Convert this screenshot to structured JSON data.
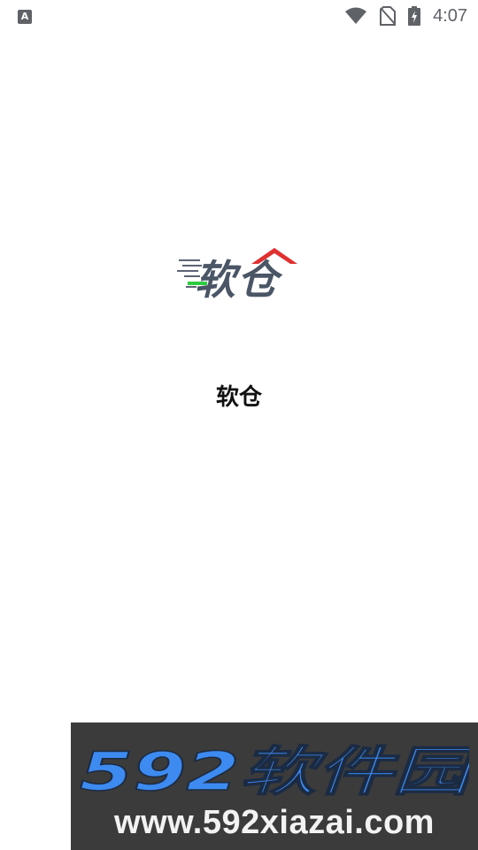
{
  "status_bar": {
    "time": "4:07",
    "left_icon_letter": "A",
    "icons": [
      "keyboard-indicator-icon",
      "wifi-icon",
      "no-sim-icon",
      "battery-charging-icon"
    ]
  },
  "splash": {
    "logo_text": "软仓",
    "app_name": "软仓"
  },
  "watermark": {
    "title": "592软件园",
    "url": "www.592xiazai.com"
  },
  "colors": {
    "logo_text": "#4a5566",
    "logo_roof": "#e03030",
    "logo_accent": "#2ecc40",
    "watermark_bg": "#3b3b3b",
    "watermark_title": "#3d8bf0"
  }
}
